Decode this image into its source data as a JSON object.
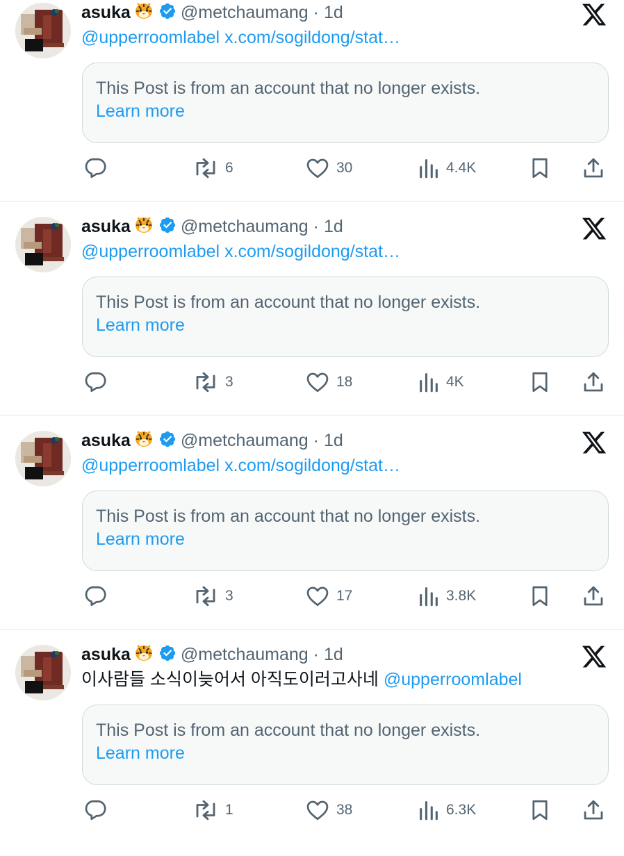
{
  "posts": [
    {
      "author_name": "asuka",
      "author_handle": "@metchaumang",
      "separator": "·",
      "time": "1d",
      "text_prefix": "",
      "text_links": [
        "@upperroomlabel",
        "x.com/sogildong/stat…"
      ],
      "quote_text": "This Post is from an account that no longer exists.",
      "quote_link": "Learn more",
      "replies": "",
      "reposts": "6",
      "likes": "30",
      "views": "4.4K"
    },
    {
      "author_name": "asuka",
      "author_handle": "@metchaumang",
      "separator": "·",
      "time": "1d",
      "text_prefix": "",
      "text_links": [
        "@upperroomlabel",
        "x.com/sogildong/stat…"
      ],
      "quote_text": "This Post is from an account that no longer exists.",
      "quote_link": "Learn more",
      "replies": "",
      "reposts": "3",
      "likes": "18",
      "views": "4K"
    },
    {
      "author_name": "asuka",
      "author_handle": "@metchaumang",
      "separator": "·",
      "time": "1d",
      "text_prefix": "",
      "text_links": [
        "@upperroomlabel",
        "x.com/sogildong/stat…"
      ],
      "quote_text": "This Post is from an account that no longer exists.",
      "quote_link": "Learn more",
      "replies": "",
      "reposts": "3",
      "likes": "17",
      "views": "3.8K"
    },
    {
      "author_name": "asuka",
      "author_handle": "@metchaumang",
      "separator": "·",
      "time": "1d",
      "text_prefix": "이사람들 소식이늦어서 아직도이러고사네",
      "text_links": [
        "@upperroomlabel"
      ],
      "quote_text": "This Post is from an account that no longer exists.",
      "quote_link": "Learn more",
      "replies": "",
      "reposts": "1",
      "likes": "38",
      "views": "6.3K"
    }
  ],
  "icons": {
    "author_emoji": "tiger-face-icon",
    "verified": "verified-badge-icon",
    "brand": "x-logo-icon",
    "reply": "reply-icon",
    "repost": "repost-icon",
    "like": "heart-icon",
    "views": "views-icon",
    "bookmark": "bookmark-icon",
    "share": "share-icon"
  },
  "colors": {
    "link": "#1d9bf0",
    "secondary_text": "#536471",
    "quote_border": "#cfd9de",
    "quote_bg": "#f7f9f9",
    "verified": "#1d9bf0"
  }
}
